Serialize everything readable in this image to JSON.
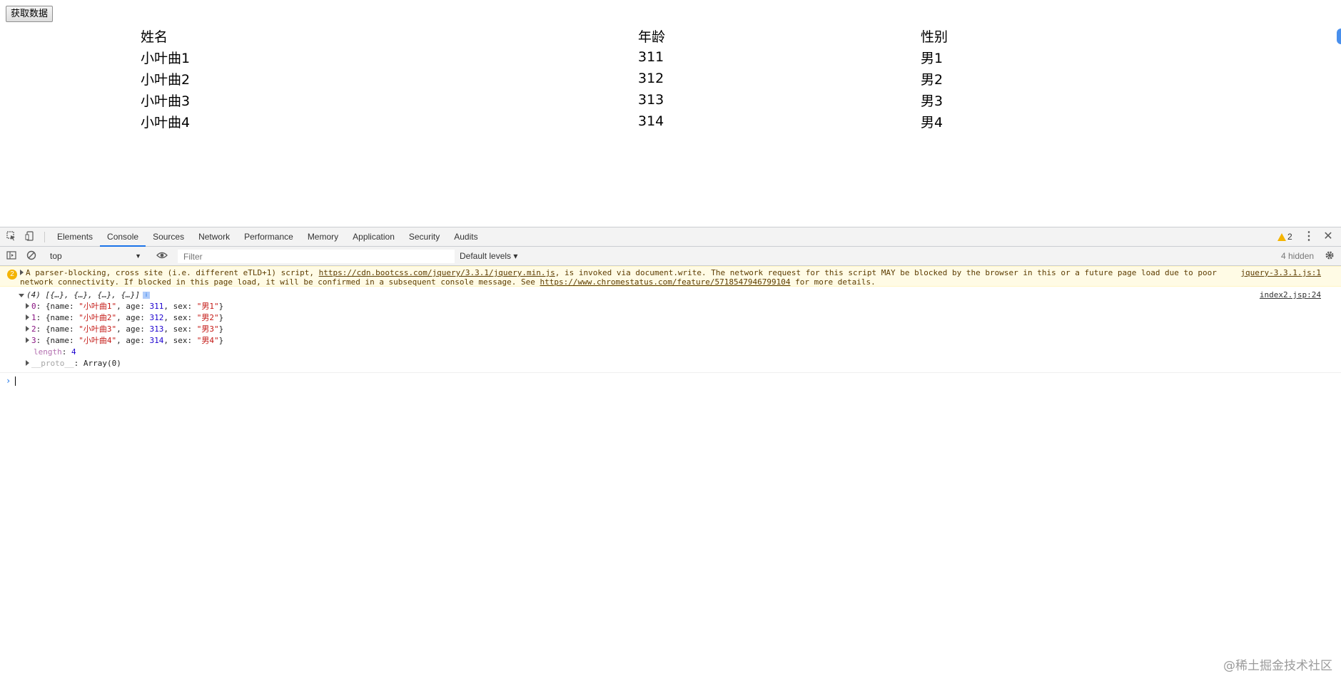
{
  "page": {
    "fetch_button": "获取数据",
    "table": {
      "headers": [
        "姓名",
        "年龄",
        "性别"
      ],
      "rows": [
        [
          "小叶曲1",
          "311",
          "男1"
        ],
        [
          "小叶曲2",
          "312",
          "男2"
        ],
        [
          "小叶曲3",
          "313",
          "男3"
        ],
        [
          "小叶曲4",
          "314",
          "男4"
        ]
      ]
    }
  },
  "devtools": {
    "tabs": [
      "Elements",
      "Console",
      "Sources",
      "Network",
      "Performance",
      "Memory",
      "Application",
      "Security",
      "Audits"
    ],
    "active_tab": "Console",
    "warning_count": "2",
    "context": "top",
    "filter_placeholder": "Filter",
    "levels": "Default levels ▾",
    "hidden": "4 hidden",
    "warning": {
      "badge": "2",
      "text_1": "A parser-blocking, cross site (i.e. different eTLD+1) script, ",
      "link_1": "https://cdn.bootcss.com/jquery/3.3.1/jquery.min.js",
      "text_2": ", is invoked via document.write. The network request for this script MAY be blocked by the browser in this or a future page load due to poor",
      "text_3": "network connectivity. If blocked in this page load, it will be confirmed in a subsequent console message. See ",
      "link_2": "https://www.chromestatus.com/feature/5718547946799104",
      "text_4": " for more details.",
      "source": "jquery-3.3.1.js:1"
    },
    "log": {
      "header": "(4) [{…}, {…}, {…}, {…}]",
      "source": "index2.jsp:24",
      "items": [
        {
          "idx": "0",
          "name": "\"小叶曲1\"",
          "age": "311",
          "sex": "\"男1\""
        },
        {
          "idx": "1",
          "name": "\"小叶曲2\"",
          "age": "312",
          "sex": "\"男2\""
        },
        {
          "idx": "2",
          "name": "\"小叶曲3\"",
          "age": "313",
          "sex": "\"男3\""
        },
        {
          "idx": "3",
          "name": "\"小叶曲4\"",
          "age": "314",
          "sex": "\"男4\""
        }
      ],
      "length_key": "length",
      "length_val": "4",
      "proto_key": "__proto__",
      "proto_val": "Array(0)"
    }
  },
  "watermark": "@稀土掘金技术社区"
}
